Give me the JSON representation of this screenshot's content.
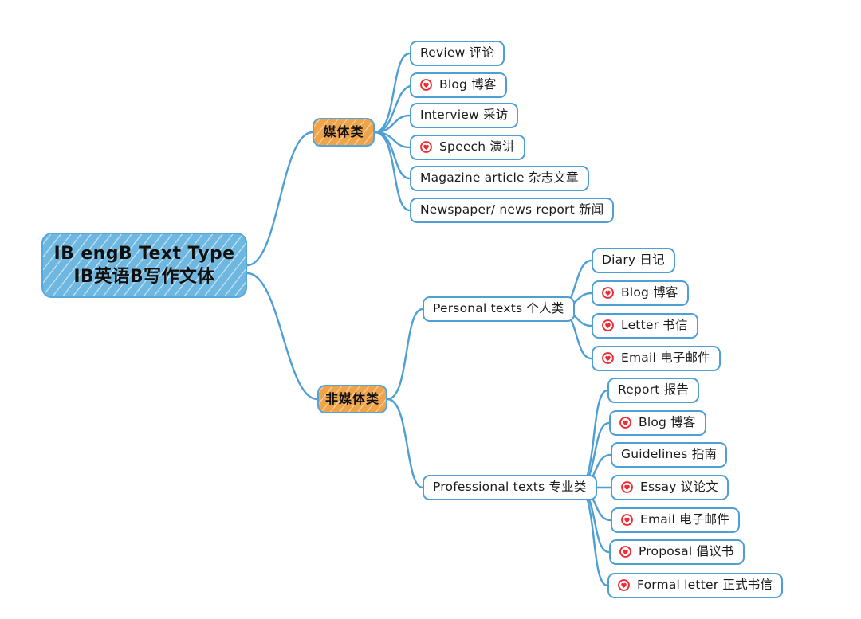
{
  "diagram": {
    "type": "mind-map",
    "title": "IB engB Text Type / IB英语B写作文体",
    "colors": {
      "link": "#4d9fd4",
      "node_border": "#4d9fd4",
      "root_fill": "#6eb7e1",
      "category_fill": "#f0a44a",
      "icon": "#ef2b33",
      "text": "#1b1b1b",
      "background": "#ffffff"
    },
    "icon_name": "heart-circle-icon"
  },
  "root": {
    "line1": "IB engB Text Type",
    "line2": "IB英语B写作文体"
  },
  "branches": [
    {
      "id": "media",
      "label": "媒体类",
      "children": [
        {
          "label": "Review 评论",
          "icon": false
        },
        {
          "label": "Blog 博客",
          "icon": true
        },
        {
          "label": "Interview 采访",
          "icon": false
        },
        {
          "label": "Speech 演讲",
          "icon": true
        },
        {
          "label": "Magazine article 杂志文章",
          "icon": false
        },
        {
          "label": "Newspaper/ news report 新闻",
          "icon": false
        }
      ]
    },
    {
      "id": "non-media",
      "label": "非媒体类",
      "groups": [
        {
          "id": "personal",
          "label": "Personal texts 个人类",
          "children": [
            {
              "label": "Diary 日记",
              "icon": false
            },
            {
              "label": "Blog 博客",
              "icon": true
            },
            {
              "label": "Letter 书信",
              "icon": true
            },
            {
              "label": "Email 电子邮件",
              "icon": true
            }
          ]
        },
        {
          "id": "professional",
          "label": "Professional texts 专业类",
          "children": [
            {
              "label": "Report 报告",
              "icon": false
            },
            {
              "label": "Blog 博客",
              "icon": true
            },
            {
              "label": "Guidelines 指南",
              "icon": false
            },
            {
              "label": "Essay 议论文",
              "icon": true
            },
            {
              "label": "Email 电子邮件",
              "icon": true
            },
            {
              "label": "Proposal 倡议书",
              "icon": true
            },
            {
              "label": "Formal letter 正式书信",
              "icon": true
            }
          ]
        }
      ]
    }
  ]
}
